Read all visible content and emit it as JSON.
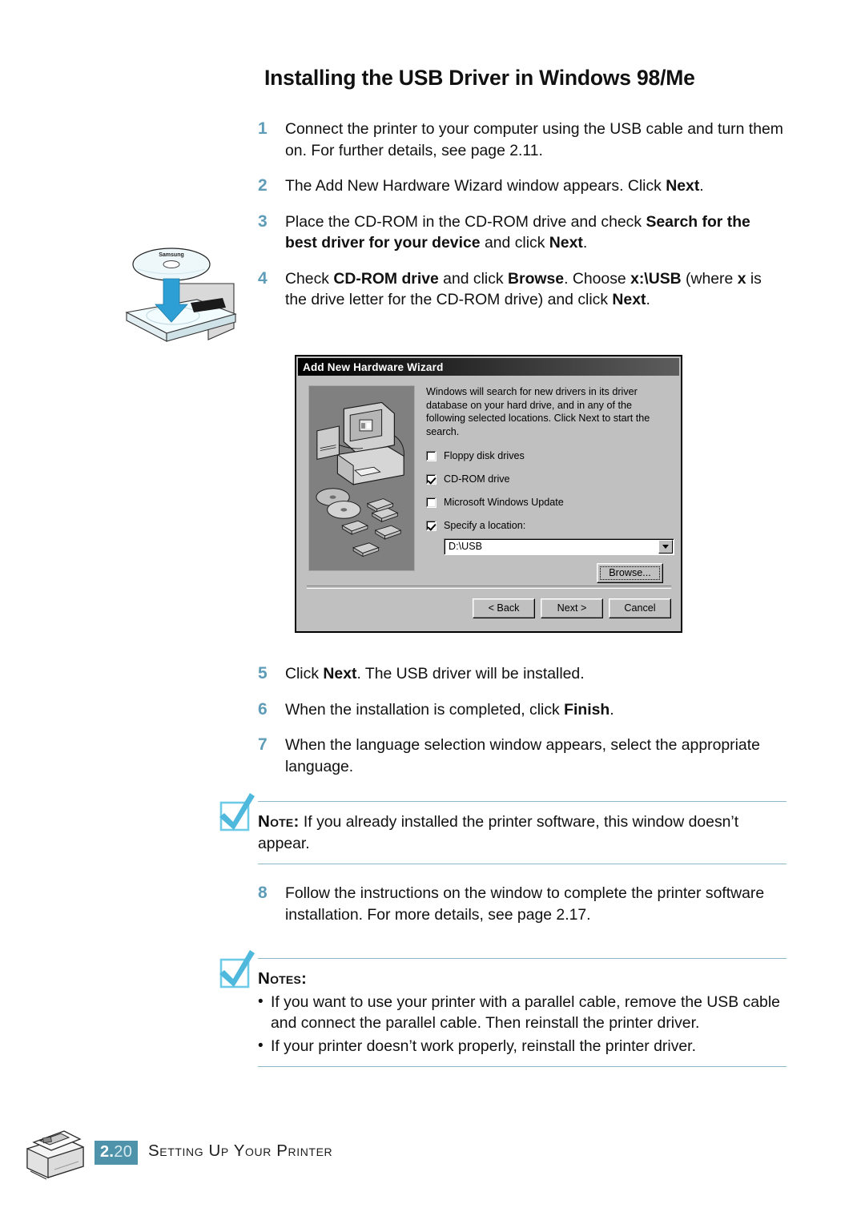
{
  "document": {
    "title": "Installing the USB Driver in Windows 98/Me"
  },
  "steps": [
    {
      "number": "1",
      "segments": [
        {
          "text": "Connect the printer to your computer using the USB cable and turn them on. For further details, see page 2.11.",
          "bold": false
        }
      ]
    },
    {
      "number": "2",
      "segments": [
        {
          "text": "The Add New Hardware Wizard window appears. Click ",
          "bold": false
        },
        {
          "text": "Next",
          "bold": true
        },
        {
          "text": ".",
          "bold": false
        }
      ]
    },
    {
      "number": "3",
      "segments": [
        {
          "text": "Place the CD-ROM in the CD-ROM drive and check ",
          "bold": false
        },
        {
          "text": "Search for the best driver for your device",
          "bold": true
        },
        {
          "text": " and click ",
          "bold": false
        },
        {
          "text": "Next",
          "bold": true
        },
        {
          "text": ".",
          "bold": false
        }
      ]
    },
    {
      "number": "4",
      "segments": [
        {
          "text": "Check ",
          "bold": false
        },
        {
          "text": "CD-ROM drive",
          "bold": true
        },
        {
          "text": " and click ",
          "bold": false
        },
        {
          "text": "Browse",
          "bold": true
        },
        {
          "text": ". Choose ",
          "bold": false
        },
        {
          "text": "x:\\USB",
          "bold": true
        },
        {
          "text": " (where ",
          "bold": false
        },
        {
          "text": "x",
          "bold": true
        },
        {
          "text": " is the drive letter for the CD-ROM drive) and click ",
          "bold": false
        },
        {
          "text": "Next",
          "bold": true
        },
        {
          "text": ".",
          "bold": false
        }
      ]
    },
    {
      "number": "5",
      "segments": [
        {
          "text": "Click ",
          "bold": false
        },
        {
          "text": "Next",
          "bold": true
        },
        {
          "text": ". The USB driver will be installed.",
          "bold": false
        }
      ]
    },
    {
      "number": "6",
      "segments": [
        {
          "text": "When the installation is completed, click ",
          "bold": false
        },
        {
          "text": "Finish",
          "bold": true
        },
        {
          "text": ".",
          "bold": false
        }
      ]
    },
    {
      "number": "7",
      "segments": [
        {
          "text": "When the language selection window appears, select the appropriate language.",
          "bold": false
        }
      ]
    },
    {
      "number": "8",
      "segments": [
        {
          "text": "Follow the instructions on the window to complete the printer software installation. For more details, see page 2.17.",
          "bold": false
        }
      ]
    }
  ],
  "cd_illustration": {
    "disc_label": "Samsung"
  },
  "wizard_dialog": {
    "title": "Add New Hardware Wizard",
    "description": "Windows will search for new drivers in its driver database on your hard drive, and in any of the following selected locations. Click Next to start the search.",
    "checkboxes": [
      {
        "label": "Floppy disk drives",
        "accelerator": "F",
        "checked": false
      },
      {
        "label": "CD-ROM drive",
        "accelerator": "C",
        "checked": true
      },
      {
        "label": "Microsoft Windows Update",
        "accelerator": "M",
        "checked": false
      },
      {
        "label": "Specify a location:",
        "accelerator": "l",
        "checked": true
      }
    ],
    "location_value": "D:\\USB",
    "browse_label": "Browse...",
    "buttons": {
      "back": "< Back",
      "next": "Next >",
      "cancel": "Cancel"
    }
  },
  "note_single": {
    "label": "Note:",
    "text": " If you already installed the printer software, this window doesn’t appear."
  },
  "notes_block": {
    "label": "Notes:",
    "bullet": "•",
    "items": [
      "If you want to use your printer with a parallel cable, remove the USB cable and connect the parallel cable. Then reinstall the printer driver.",
      "If your printer doesn’t work properly, reinstall the printer driver."
    ]
  },
  "footer": {
    "page_major": "2.",
    "page_minor": "20",
    "section_title": "Setting Up Your Printer"
  },
  "colors": {
    "step_number": "#5f9cb8",
    "rule": "#8fb8cb",
    "page_badge_bg": "#4f93ab",
    "check_icon": "#4fb8dd",
    "dialog_face": "#c0c0c0"
  }
}
